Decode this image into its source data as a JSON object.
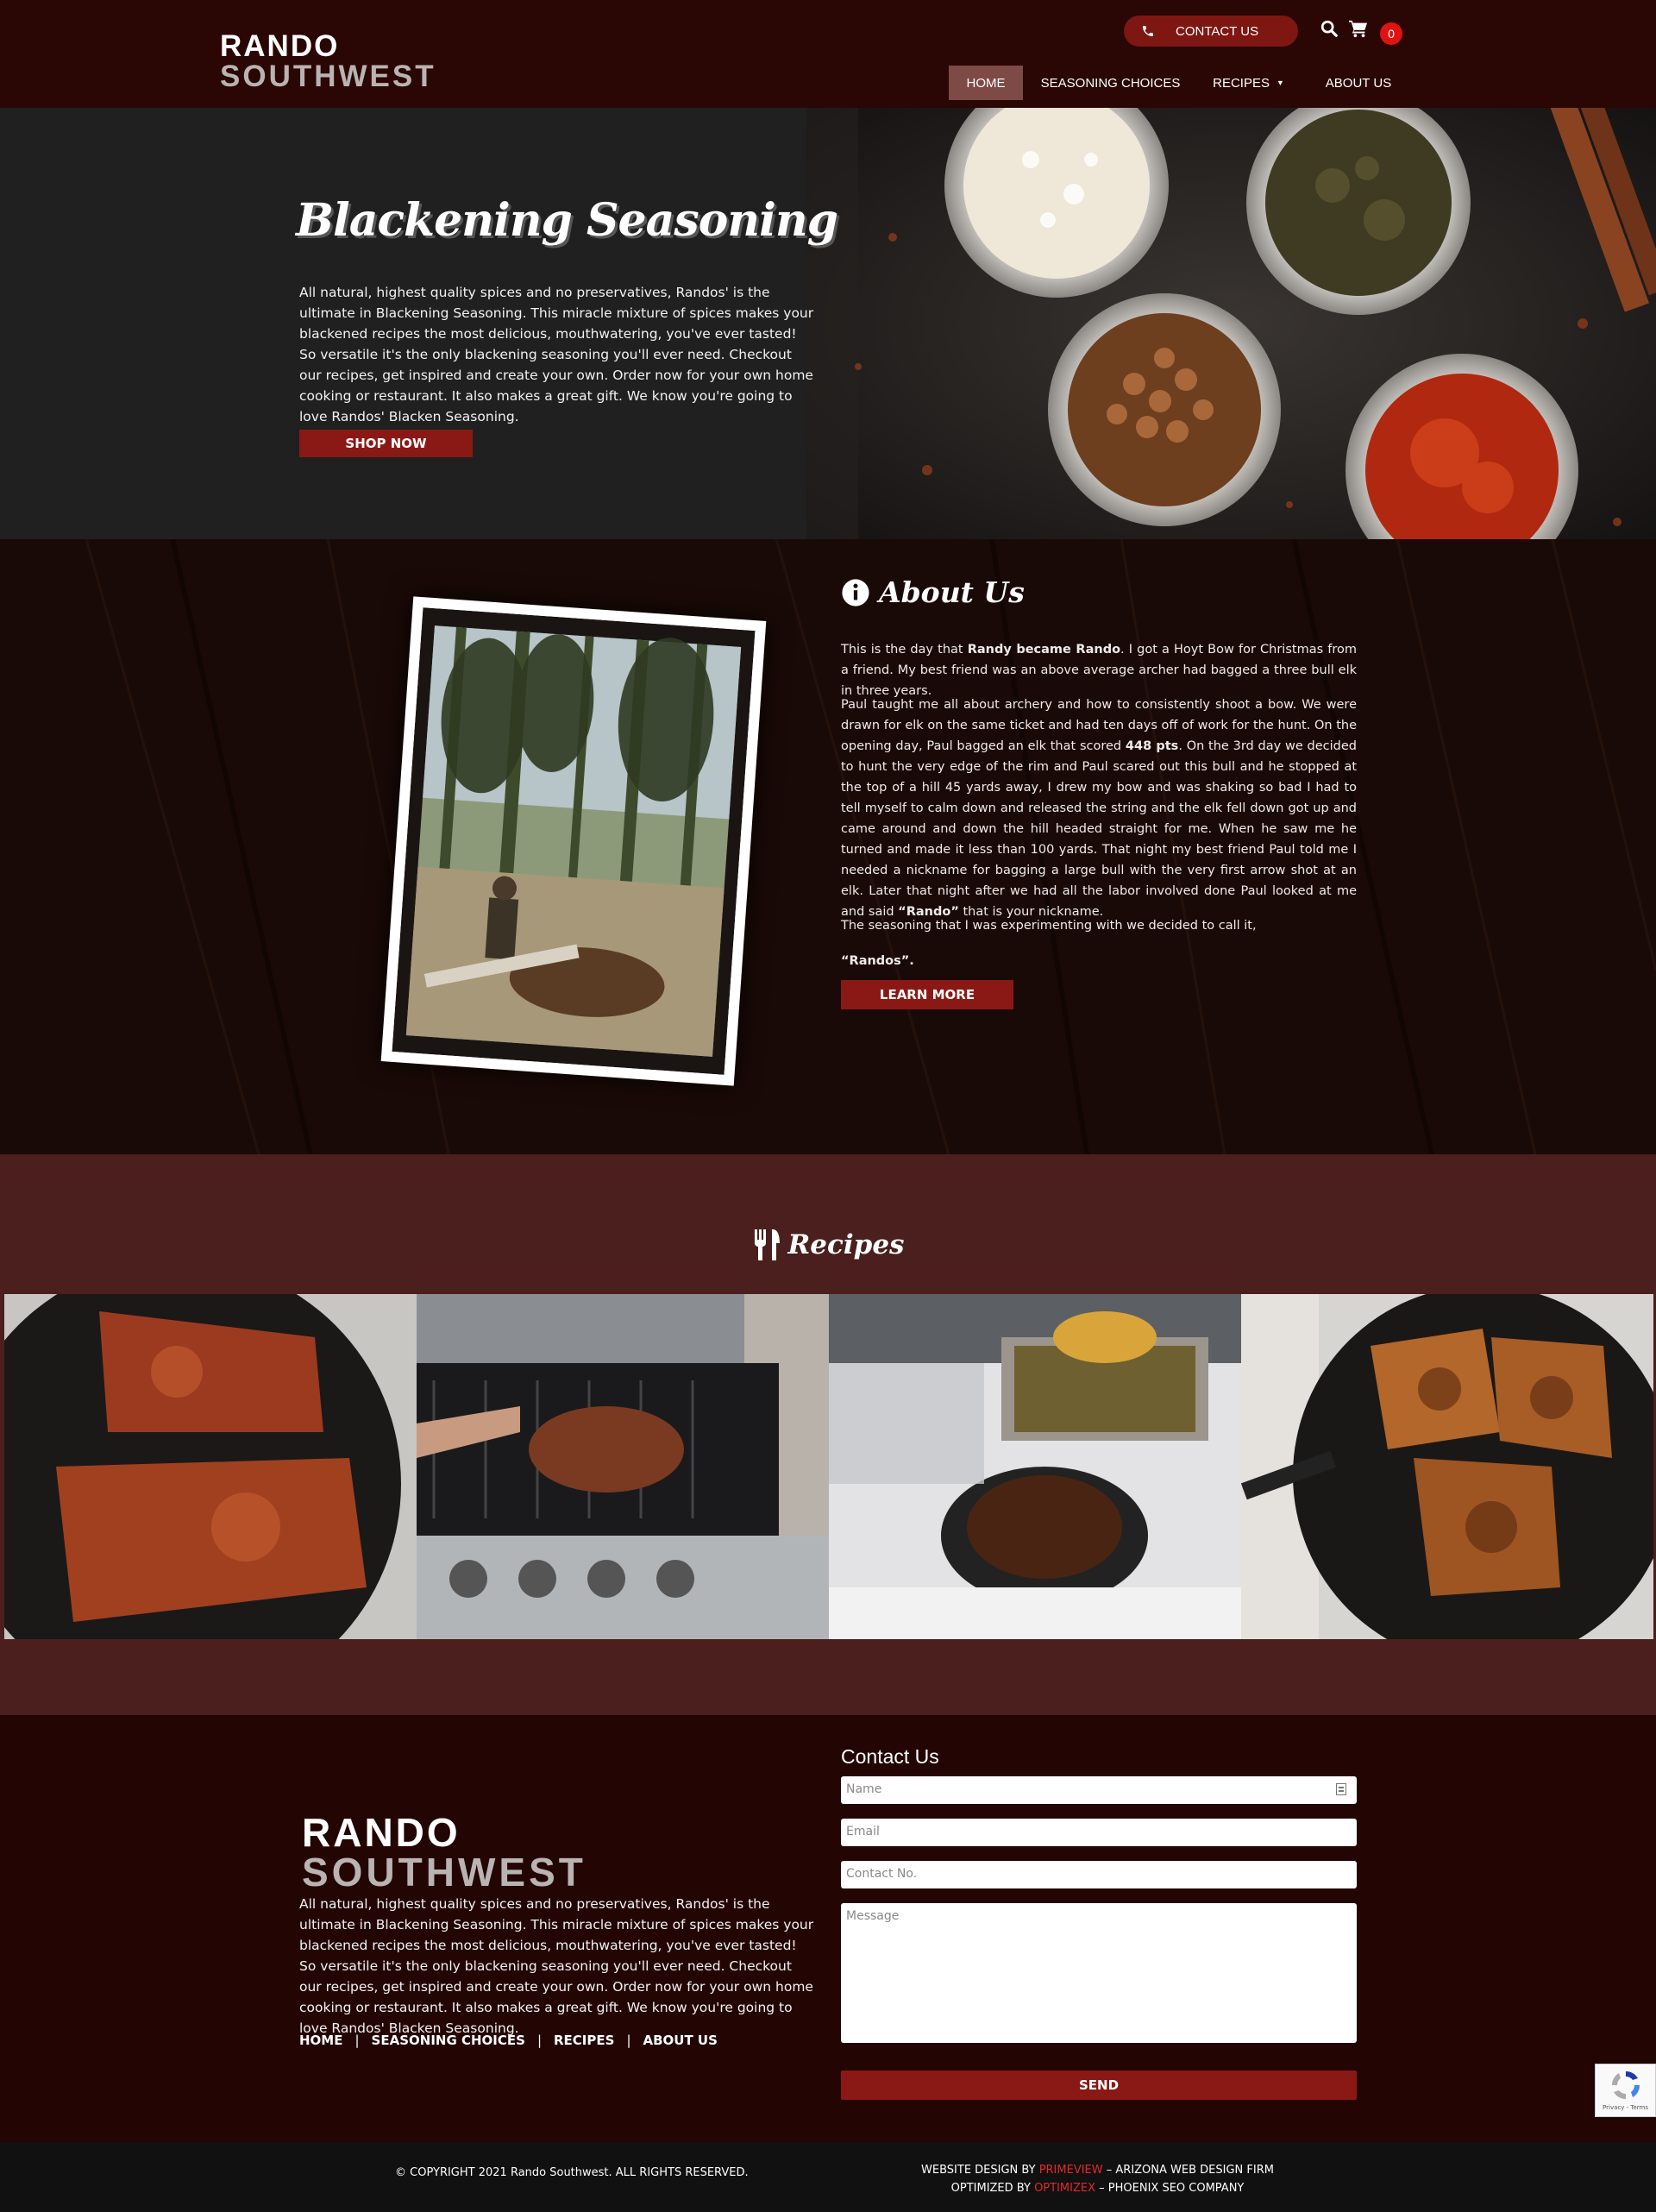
{
  "header": {
    "logo_line1": "RANDO",
    "logo_line2": "SOUTHWEST",
    "contact_label": "CONTACT US",
    "cart_count": "0",
    "nav": {
      "home": "HOME",
      "seasoning": "SEASONING CHOICES",
      "recipes": "RECIPES",
      "about": "ABOUT US"
    }
  },
  "hero": {
    "title": "Blackening Seasoning",
    "text": "All natural, highest quality spices and no preservatives,  Randos' is the ultimate in Blackening Seasoning. This miracle mixture of spices makes your blackened recipes the most delicious, mouthwatering, you've ever tasted! So versatile it's the only blackening seasoning you'll ever need. Checkout our recipes, get inspired and create your own. Order now for your own home cooking or restaurant.  It also makes a great gift. We know you're going to love  Randos'  Blacken Seasoning.",
    "button": "SHOP NOW"
  },
  "about": {
    "title": "About Us",
    "p1_pre": "This is the day that ",
    "p1_bold": "Randy became Rando",
    "p1_post": ".  I got a  Hoyt  Bow for Christmas from a friend. My best friend was an above average archer had bagged a three bull elk in three years.",
    "p2_pre": "Paul taught me all about archery and how to consistently shoot a bow. We were drawn for elk on the same ticket and had ten days off of work for the hunt. On the opening day, Paul bagged an elk that scored ",
    "p2_bold": "448 pts",
    "p2_mid": ". On the 3rd day we decided to hunt the very edge of the rim and  Paul scared out this bull and he stopped at the top of a hill 45 yards away,  I drew my bow and was shaking so bad  I had to tell myself to calm down and released the string and the elk fell down got up and came around and down the hill headed straight for me. When he saw me he turned and made it less than 100 yards. That night my best friend  Paul told me  I needed a nickname for bagging a large bull with the very first arrow shot at an elk.  Later that night after we had all the labor involved done  Paul looked at me and said ",
    "p2_bold2": "“Rando”",
    "p2_post": " that is your nickname.",
    "p3": "The seasoning that  I was experimenting with we decided to call it,",
    "p4": "“Randos”.",
    "button": "LEARN MORE"
  },
  "recipes": {
    "title": "Recipes"
  },
  "footer": {
    "logo_line1": "RANDO",
    "logo_line2": "SOUTHWEST",
    "text": "All natural, highest quality spices and no preservatives,  Randos' is the ultimate in Blackening Seasoning. This miracle mixture of spices makes your blackened recipes the most delicious, mouthwatering, you've ever tasted! So versatile it's the only blackening seasoning you'll ever need. Checkout our recipes, get inspired and create your own. Order now for your own home cooking or restaurant.  It also makes a great gift. We know you're going to love  Randos'  Blacken Seasoning.",
    "links": {
      "home": "HOME",
      "seasoning": "SEASONING CHOICES",
      "recipes": "RECIPES",
      "about": "ABOUT US",
      "separator": "|"
    },
    "contact": {
      "title": "Contact Us",
      "name_placeholder": "Name",
      "email_placeholder": "Email",
      "phone_placeholder": "Contact No.",
      "message_placeholder": "Message",
      "send": "SEND"
    }
  },
  "bottom": {
    "copyright": "COPYRIGHT 2021  Rando Southwest. ALL  RIGHTS  RESERVED.",
    "credit1_pre": "WEBSITE  DESIGN  BY ",
    "credit1_brand": "PRIMEVIEW",
    "credit1_post": " – ARIZONA WEB  DESIGN  FIRM",
    "credit2_pre": "OPTIMIZED  BY ",
    "credit2_brand": "OPTIMIZEX",
    "credit2_post": " –  PHOENIX SEO COMPANY",
    "recaptcha_text": "Privacy - Terms"
  },
  "colors": {
    "brand_red": "#8a1915",
    "header_bg": "#2a0604",
    "recipes_bg": "#4a1f1d",
    "nav_active": "#7e4a46"
  }
}
